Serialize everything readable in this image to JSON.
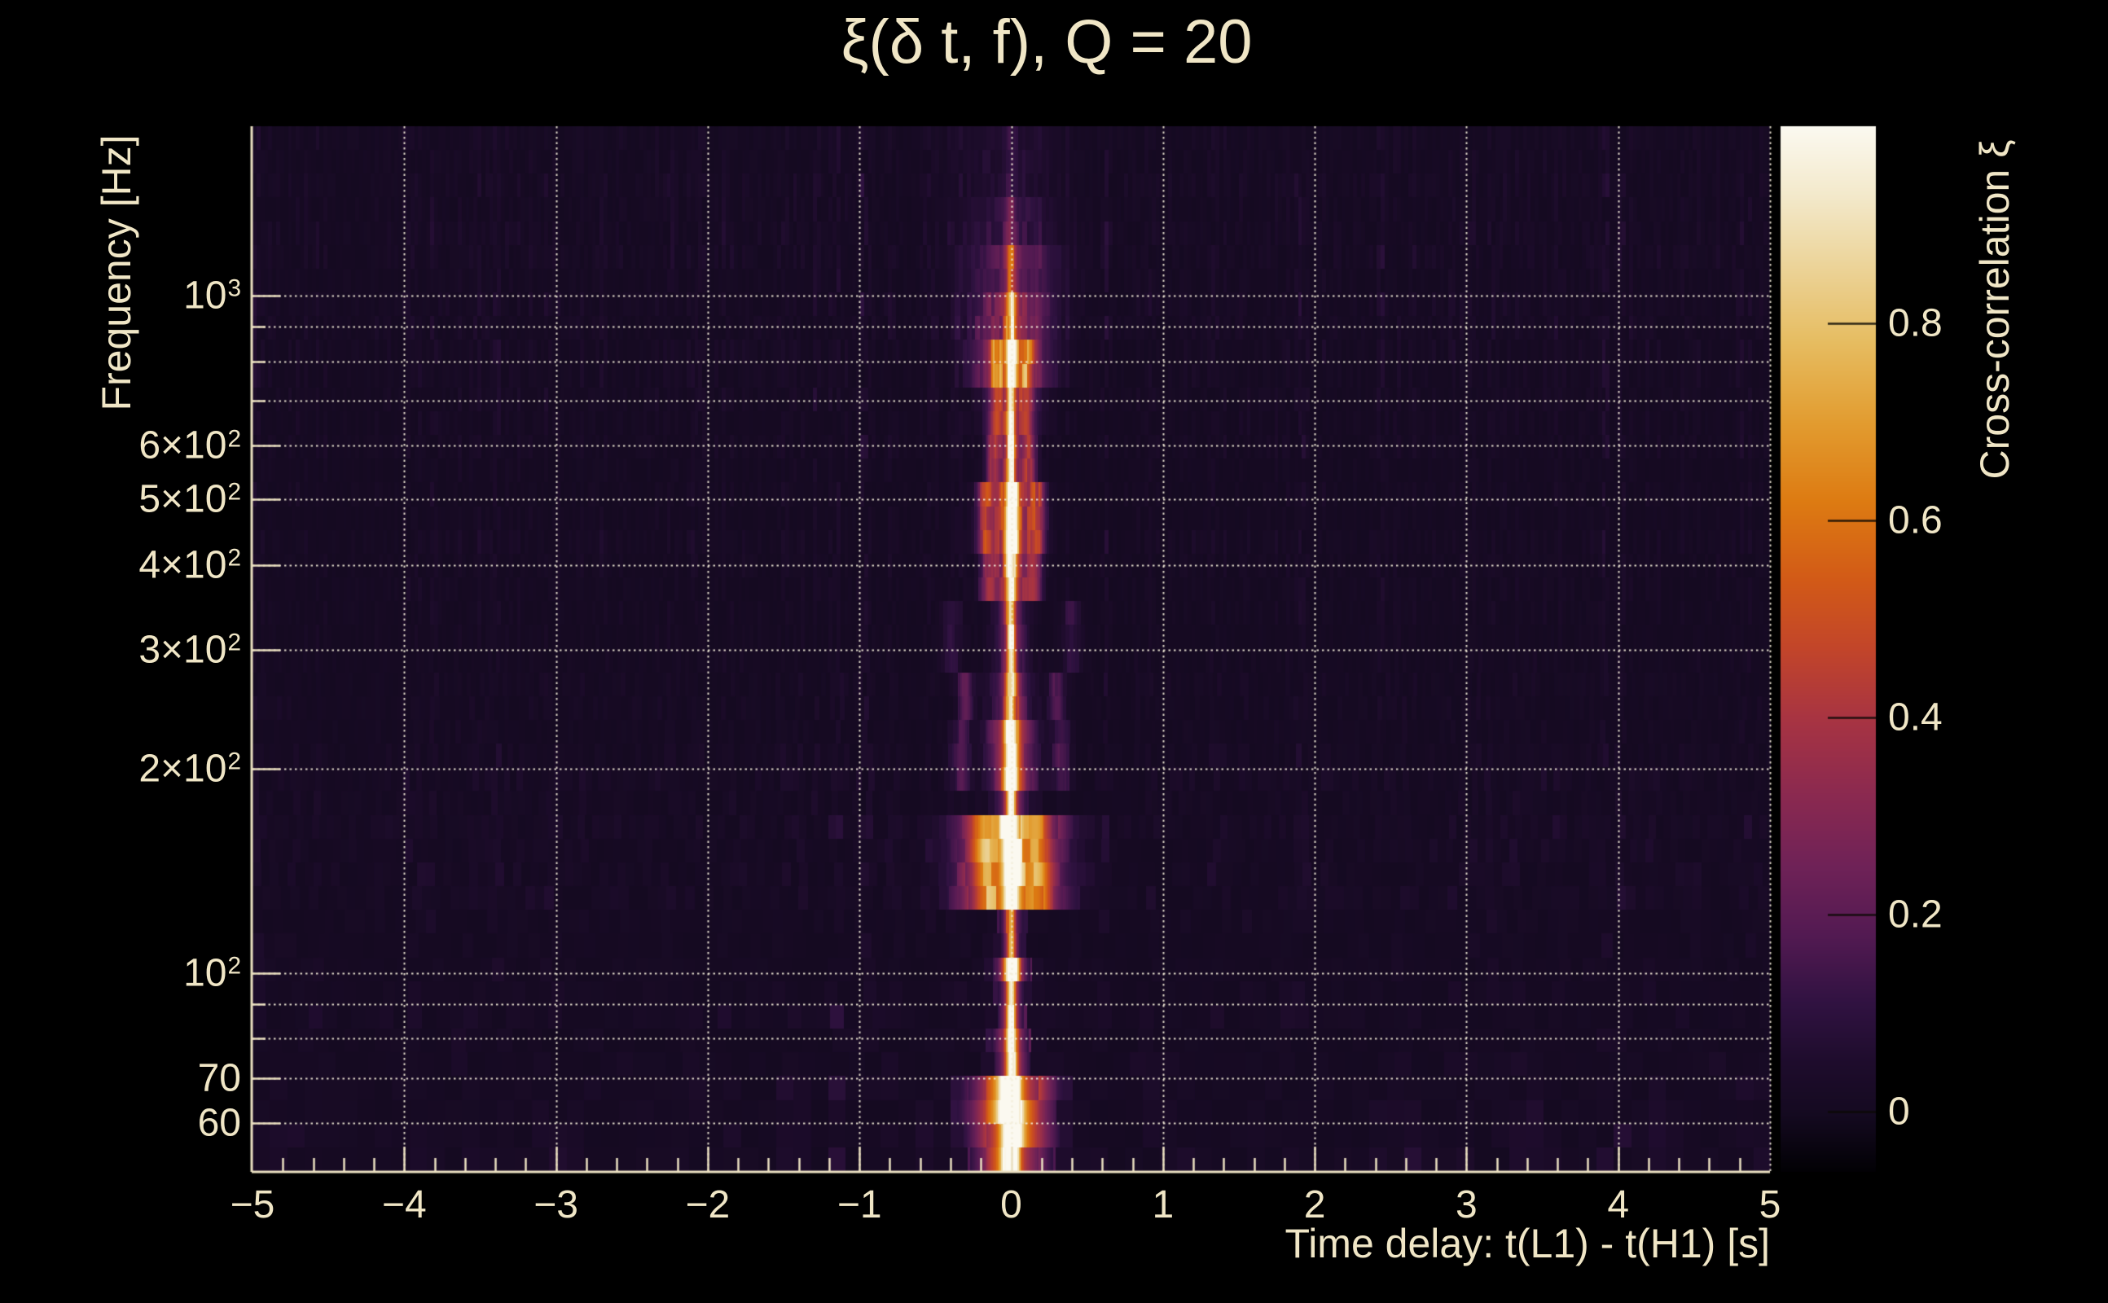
{
  "title": "ξ(δ t, f), Q = 20",
  "axes": {
    "x": {
      "label": "Time delay: t(L1) - t(H1) [s]",
      "min": -5,
      "max": 5,
      "minor_step": 0.2,
      "ticks": [
        {
          "v": -5,
          "text": "−5"
        },
        {
          "v": -4,
          "text": "−4"
        },
        {
          "v": -3,
          "text": "−3"
        },
        {
          "v": -2,
          "text": "−2"
        },
        {
          "v": -1,
          "text": "−1"
        },
        {
          "v": 0,
          "text": "0"
        },
        {
          "v": 1,
          "text": "1"
        },
        {
          "v": 2,
          "text": "2"
        },
        {
          "v": 3,
          "text": "3"
        },
        {
          "v": 4,
          "text": "4"
        },
        {
          "v": 5,
          "text": "5"
        }
      ]
    },
    "y": {
      "label": "Frequency [Hz]",
      "scale": "log",
      "min": 51,
      "max": 1778,
      "gridlines": [
        60,
        70,
        80,
        90,
        100,
        200,
        300,
        400,
        500,
        600,
        700,
        800,
        900,
        1000
      ],
      "labeled": [
        60,
        70,
        100,
        200,
        300,
        400,
        500,
        600,
        1000
      ],
      "ticks": [
        {
          "f": 1000,
          "text": "10",
          "sup": "3"
        },
        {
          "f": 600,
          "text": "6×10",
          "sup": "2"
        },
        {
          "f": 500,
          "text": "5×10",
          "sup": "2"
        },
        {
          "f": 400,
          "text": "4×10",
          "sup": "2"
        },
        {
          "f": 300,
          "text": "3×10",
          "sup": "2"
        },
        {
          "f": 200,
          "text": "2×10",
          "sup": "2"
        },
        {
          "f": 100,
          "text": "10",
          "sup": "2"
        },
        {
          "f": 70,
          "text": "70",
          "sup": ""
        },
        {
          "f": 60,
          "text": "60",
          "sup": ""
        }
      ]
    }
  },
  "colorbar": {
    "label": "Cross-correlation ξ",
    "min": -0.06,
    "max": 1.0,
    "ticks": [
      {
        "v": 0.8,
        "text": "0.8"
      },
      {
        "v": 0.6,
        "text": "0.6"
      },
      {
        "v": 0.4,
        "text": "0.4"
      },
      {
        "v": 0.2,
        "text": "0.2"
      },
      {
        "v": 0.0,
        "text": "0"
      }
    ]
  },
  "colors": {
    "background": "#000000",
    "text": "#f0e6c6",
    "axis": "#eadfc0",
    "grid": "#f3edd8"
  },
  "colormap": [
    [
      -0.06,
      "#020105"
    ],
    [
      0.0,
      "#150a21"
    ],
    [
      0.05,
      "#1e0c2c"
    ],
    [
      0.11,
      "#301241"
    ],
    [
      0.18,
      "#531a52"
    ],
    [
      0.25,
      "#6f2257"
    ],
    [
      0.32,
      "#8a2950"
    ],
    [
      0.4,
      "#a83442"
    ],
    [
      0.47,
      "#c2452a"
    ],
    [
      0.54,
      "#d25a17"
    ],
    [
      0.62,
      "#dd7b12"
    ],
    [
      0.7,
      "#e29c30"
    ],
    [
      0.78,
      "#e6bc60"
    ],
    [
      0.86,
      "#ecd49a"
    ],
    [
      0.93,
      "#f3e9cb"
    ],
    [
      1.0,
      "#fbf9f0"
    ]
  ],
  "chart_data": {
    "type": "heatmap",
    "title": "ξ(δ t, f), Q = 20",
    "xlabel": "Time delay: t(L1) - t(H1) [s]",
    "ylabel": "Frequency [Hz]",
    "x_range_s": [
      -5,
      5
    ],
    "y_range_hz": [
      51,
      1778
    ],
    "y_scale": "log",
    "color_range": [
      -0.06,
      1.0
    ],
    "legend": "Cross-correlation ξ",
    "peak": {
      "time_delay_s": 0.0,
      "frequency_hz": 60,
      "cross_correlation": 0.95
    },
    "seed": 20,
    "background_noise_level": 0.04,
    "signal_bands": [
      {
        "f_lo": 50,
        "f_hi": 57,
        "core": 0.95,
        "core_w": 0.05,
        "halo": 0.55,
        "halo_w": 0.2,
        "side_off": 0,
        "side": 0,
        "side_w": 0
      },
      {
        "f_lo": 57,
        "f_hi": 68,
        "core": 0.98,
        "core_w": 0.06,
        "halo": 0.7,
        "halo_w": 0.22,
        "side_off": 0,
        "side": 0,
        "side_w": 0
      },
      {
        "f_lo": 68,
        "f_hi": 80,
        "core": 0.8,
        "core_w": 0.035,
        "halo": 0.35,
        "halo_w": 0.1,
        "side_off": 0,
        "side": 0,
        "side_w": 0
      },
      {
        "f_lo": 80,
        "f_hi": 95,
        "core": 0.7,
        "core_w": 0.03,
        "halo": 0.26,
        "halo_w": 0.08,
        "side_off": 0,
        "side": 0,
        "side_w": 0
      },
      {
        "f_lo": 95,
        "f_hi": 106,
        "core": 0.92,
        "core_w": 0.045,
        "halo": 0.4,
        "halo_w": 0.1,
        "side_off": 0,
        "side": 0,
        "side_w": 0
      },
      {
        "f_lo": 106,
        "f_hi": 122,
        "core": 0.68,
        "core_w": 0.028,
        "halo": 0.22,
        "halo_w": 0.07,
        "side_off": 0,
        "side": 0,
        "side_w": 0
      },
      {
        "f_lo": 122,
        "f_hi": 168,
        "core": 0.88,
        "core_w": 0.05,
        "halo": 0.62,
        "halo_w": 0.3,
        "side_off": 0.18,
        "side": 0.25,
        "side_w": 0.08
      },
      {
        "f_lo": 168,
        "f_hi": 188,
        "core": 0.7,
        "core_w": 0.03,
        "halo": 0.28,
        "halo_w": 0.1,
        "side_off": 0,
        "side": 0,
        "side_w": 0
      },
      {
        "f_lo": 188,
        "f_hi": 235,
        "core": 0.8,
        "core_w": 0.04,
        "halo": 0.4,
        "halo_w": 0.14,
        "side_off": 0.33,
        "side": 0.15,
        "side_w": 0.06
      },
      {
        "f_lo": 235,
        "f_hi": 275,
        "core": 0.74,
        "core_w": 0.035,
        "halo": 0.28,
        "halo_w": 0.12,
        "side_off": 0.3,
        "side": 0.18,
        "side_w": 0.05
      },
      {
        "f_lo": 275,
        "f_hi": 340,
        "core": 0.7,
        "core_w": 0.03,
        "halo": 0.22,
        "halo_w": 0.1,
        "side_off": 0.4,
        "side": 0.1,
        "side_w": 0.06
      },
      {
        "f_lo": 340,
        "f_hi": 420,
        "core": 0.84,
        "core_w": 0.035,
        "halo": 0.4,
        "halo_w": 0.12,
        "side_off": 0.15,
        "side": 0.28,
        "side_w": 0.05
      },
      {
        "f_lo": 420,
        "f_hi": 520,
        "core": 0.92,
        "core_w": 0.04,
        "halo": 0.48,
        "halo_w": 0.15,
        "side_off": 0.17,
        "side": 0.33,
        "side_w": 0.05
      },
      {
        "f_lo": 520,
        "f_hi": 620,
        "core": 0.72,
        "core_w": 0.03,
        "halo": 0.3,
        "halo_w": 0.12,
        "side_off": 0.12,
        "side": 0.3,
        "side_w": 0.04
      },
      {
        "f_lo": 620,
        "f_hi": 720,
        "core": 0.66,
        "core_w": 0.03,
        "halo": 0.32,
        "halo_w": 0.15,
        "side_off": 0.1,
        "side": 0.25,
        "side_w": 0.04
      },
      {
        "f_lo": 720,
        "f_hi": 860,
        "core": 0.8,
        "core_w": 0.035,
        "halo": 0.45,
        "halo_w": 0.22,
        "side_off": 0.1,
        "side": 0.35,
        "side_w": 0.04
      },
      {
        "f_lo": 860,
        "f_hi": 1000,
        "core": 0.62,
        "core_w": 0.035,
        "halo": 0.3,
        "halo_w": 0.25,
        "side_off": 0,
        "side": 0,
        "side_w": 0
      },
      {
        "f_lo": 1000,
        "f_hi": 1200,
        "core": 0.32,
        "core_w": 0.04,
        "halo": 0.18,
        "halo_w": 0.3,
        "side_off": 0,
        "side": 0,
        "side_w": 0
      },
      {
        "f_lo": 1200,
        "f_hi": 1450,
        "core": 0.16,
        "core_w": 0.04,
        "halo": 0.1,
        "halo_w": 0.3,
        "side_off": 0,
        "side": 0,
        "side_w": 0
      },
      {
        "f_lo": 1450,
        "f_hi": 1780,
        "core": 0.06,
        "core_w": 0.04,
        "halo": 0.05,
        "halo_w": 0.3,
        "side_off": 0,
        "side": 0,
        "side_w": 0
      }
    ],
    "noise_bands": [
      {
        "f_lo": 50,
        "f_hi": 70,
        "amp": 0.07
      },
      {
        "f_lo": 70,
        "f_hi": 120,
        "amp": 0.045
      },
      {
        "f_lo": 120,
        "f_hi": 200,
        "amp": 0.055
      },
      {
        "f_lo": 200,
        "f_hi": 700,
        "amp": 0.04
      },
      {
        "f_lo": 700,
        "f_hi": 1100,
        "amp": 0.055
      },
      {
        "f_lo": 1100,
        "f_hi": 1780,
        "amp": 0.05
      }
    ]
  }
}
